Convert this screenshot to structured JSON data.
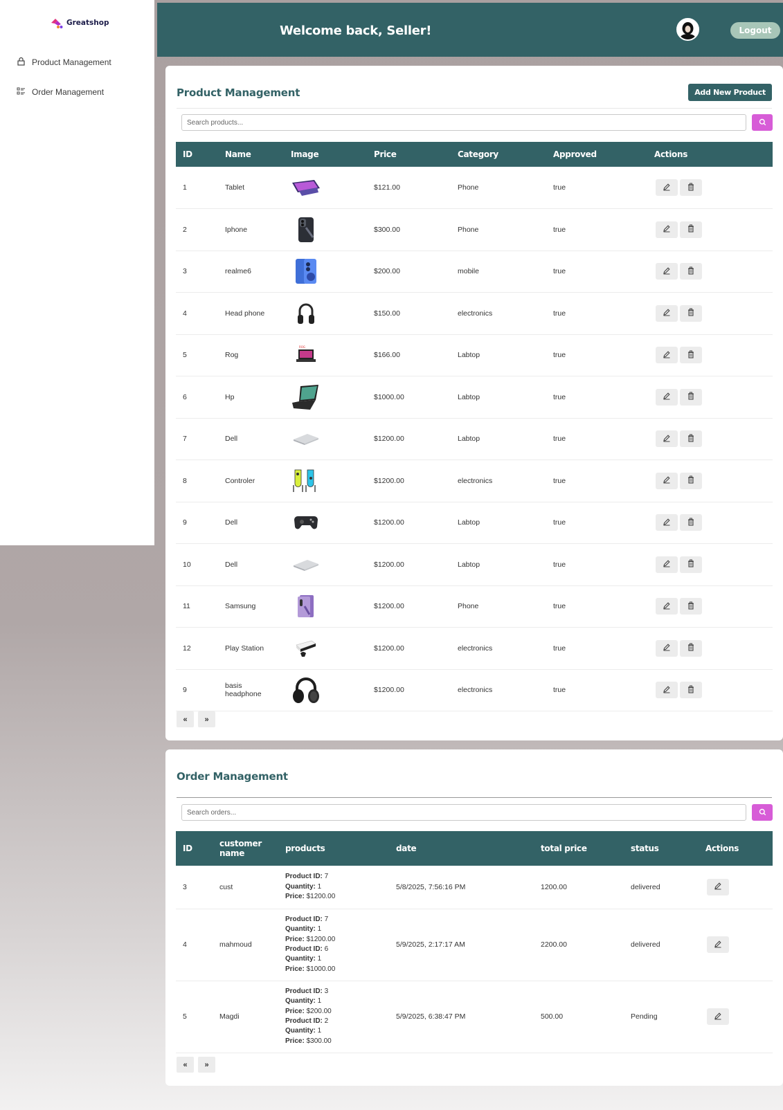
{
  "brand": {
    "name": "Greatshop"
  },
  "sidebar": {
    "items": [
      {
        "label": "Product Management"
      },
      {
        "label": "Order Management"
      }
    ]
  },
  "header": {
    "title": "Welcome back, Seller!",
    "logout_label": "Logout"
  },
  "products": {
    "title": "Product Management",
    "add_button": "Add New Product",
    "search_placeholder": "Search products...",
    "columns": [
      "ID",
      "Name",
      "Image",
      "Price",
      "Category",
      "Approved",
      "Actions"
    ],
    "rows": [
      {
        "id": "1",
        "name": "Tablet",
        "image": "tablet",
        "price": "$121.00",
        "category": "Phone",
        "approved": "true"
      },
      {
        "id": "2",
        "name": "Iphone",
        "image": "iphone",
        "price": "$300.00",
        "category": "Phone",
        "approved": "true"
      },
      {
        "id": "3",
        "name": "realme6",
        "image": "phone-blue",
        "price": "$200.00",
        "category": "mobile",
        "approved": "true"
      },
      {
        "id": "4",
        "name": "Head phone",
        "image": "headphone",
        "price": "$150.00",
        "category": "electronics",
        "approved": "true"
      },
      {
        "id": "5",
        "name": "Rog",
        "image": "laptop-small",
        "price": "$166.00",
        "category": "Labtop",
        "approved": "true"
      },
      {
        "id": "6",
        "name": "Hp",
        "image": "laptop-open",
        "price": "$1000.00",
        "category": "Labtop",
        "approved": "true"
      },
      {
        "id": "7",
        "name": "Dell",
        "image": "laptop-silver",
        "price": "$1200.00",
        "category": "Labtop",
        "approved": "true"
      },
      {
        "id": "8",
        "name": "Controler",
        "image": "joycons",
        "price": "$1200.00",
        "category": "electronics",
        "approved": "true"
      },
      {
        "id": "9",
        "name": "Dell",
        "image": "gamepad",
        "price": "$1200.00",
        "category": "Labtop",
        "approved": "true"
      },
      {
        "id": "10",
        "name": "Dell",
        "image": "laptop-silver",
        "price": "$1200.00",
        "category": "Labtop",
        "approved": "true"
      },
      {
        "id": "11",
        "name": "Samsung",
        "image": "phone-purple",
        "price": "$1200.00",
        "category": "Phone",
        "approved": "true"
      },
      {
        "id": "12",
        "name": "Play Station",
        "image": "console",
        "price": "$1200.00",
        "category": "electronics",
        "approved": "true"
      },
      {
        "id": "9",
        "name": "basis headphone",
        "image": "headphone-large",
        "price": "$1200.00",
        "category": "electronics",
        "approved": "true"
      }
    ],
    "pager": {
      "prev": "«",
      "next": "»"
    }
  },
  "orders": {
    "title": "Order Management",
    "search_placeholder": "Search orders...",
    "columns": [
      "ID",
      "customer name",
      "products",
      "date",
      "total price",
      "status",
      "Actions"
    ],
    "line_labels": {
      "product_id": "Product ID:",
      "quantity": "Quantity:",
      "price": "Price:"
    },
    "rows": [
      {
        "id": "3",
        "customer": "cust",
        "items": [
          {
            "product_id": "7",
            "quantity": "1",
            "price": "$1200.00"
          }
        ],
        "date": "5/8/2025, 7:56:16 PM",
        "total": "1200.00",
        "status": "delivered"
      },
      {
        "id": "4",
        "customer": "mahmoud",
        "items": [
          {
            "product_id": "7",
            "quantity": "1",
            "price": "$1200.00"
          },
          {
            "product_id": "6",
            "quantity": "1",
            "price": "$1000.00"
          }
        ],
        "date": "5/9/2025, 2:17:17 AM",
        "total": "2200.00",
        "status": "delivered"
      },
      {
        "id": "5",
        "customer": "Magdi",
        "items": [
          {
            "product_id": "3",
            "quantity": "1",
            "price": "$200.00"
          },
          {
            "product_id": "2",
            "quantity": "1",
            "price": "$300.00"
          }
        ],
        "date": "5/9/2025, 6:38:47 PM",
        "total": "500.00",
        "status": "Pending"
      }
    ],
    "pager": {
      "prev": "«",
      "next": "»"
    }
  },
  "colors": {
    "primary": "#336266",
    "search_button": "#d75cd7",
    "logout_button": "#a8c6b8"
  }
}
